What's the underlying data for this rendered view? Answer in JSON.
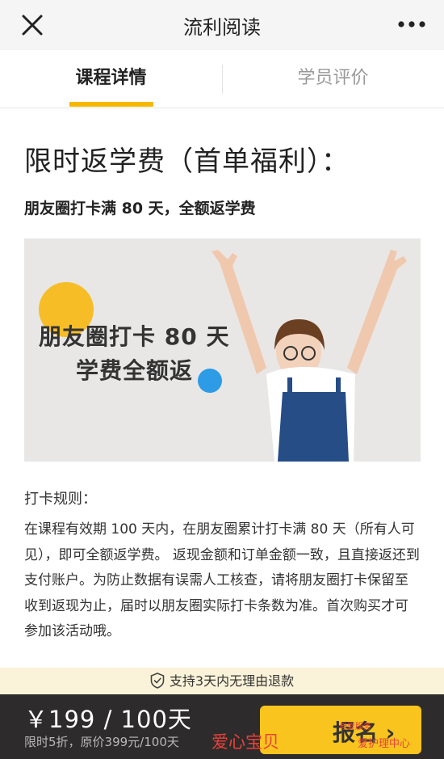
{
  "titlebar": {
    "title": "流利阅读",
    "close_icon": "close-icon",
    "more_icon": "more-icon"
  },
  "tabs": [
    {
      "label": "课程详情",
      "active": true
    },
    {
      "label": "学员评价",
      "active": false
    }
  ],
  "headline": "限时返学费（首单福利）：",
  "subhead": "朋友圈打卡满 80 天，全额返学费",
  "banner": {
    "line1": "朋友圈打卡 80 天",
    "line2": "学费全额返"
  },
  "rules": {
    "title": "打卡规则：",
    "body": "在课程有效期 100 天内，在朋友圈累计打卡满 80 天（所有人可见），即可全额返学费。 返现金额和订单金额一致，且直接返还到支付账户。为防止数据有误需人工核查，请将朋友圈打卡保留至收到返现为止，届时以朋友圈实际打卡条数为准。首次购买才可参加该活动哦。"
  },
  "refund_notice": "支持3天内无理由退款",
  "bottom_bar": {
    "price": "￥199 / 100天",
    "price_sub": "限时5折，原价399元/100天",
    "signup_label": "报名 ›"
  },
  "watermark": {
    "left": "爱心宝贝",
    "mid": "母婴服务",
    "right": "爱护理中心"
  },
  "colors": {
    "accent": "#f5b800",
    "button": "#f9c41e",
    "bar": "#2d2b2b",
    "notice_bg": "#fbf3d9"
  }
}
